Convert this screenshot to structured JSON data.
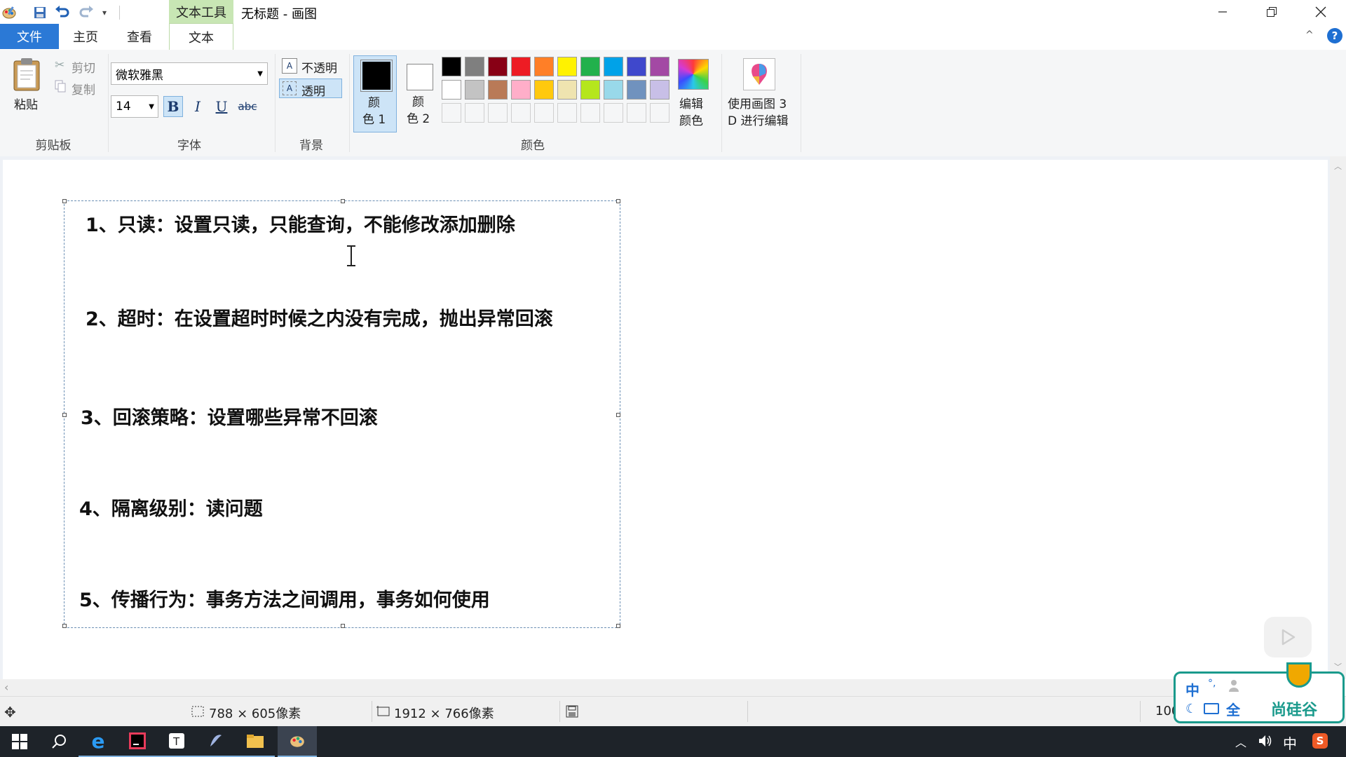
{
  "app": {
    "title": "无标题 - 画图",
    "contextual_tab_group": "文本工具"
  },
  "tabs": [
    {
      "label": "文件",
      "active": false
    },
    {
      "label": "主页",
      "active": false
    },
    {
      "label": "查看",
      "active": false
    },
    {
      "label": "文本",
      "active": true
    }
  ],
  "clipboard": {
    "paste": "粘贴",
    "cut": "剪切",
    "copy": "复制",
    "group_label": "剪贴板"
  },
  "font": {
    "family": "微软雅黑",
    "size": "14",
    "bold": "B",
    "italic": "I",
    "underline": "U",
    "strike": "abc",
    "group_label": "字体"
  },
  "background": {
    "opaque": "不透明",
    "transparent": "透明",
    "group_label": "背景"
  },
  "colors": {
    "color1_a": "颜",
    "color1_b": "色 1",
    "color2_a": "颜",
    "color2_b": "色 2",
    "edit_a": "编辑",
    "edit_b": "颜色",
    "group_label": "颜色",
    "color1_value": "#000000",
    "color2_value": "#ffffff",
    "palette_row1": [
      "#000000",
      "#7f7f7f",
      "#880015",
      "#ed1c24",
      "#ff7f27",
      "#fff200",
      "#22b14c",
      "#00a2e8",
      "#3f48cc",
      "#a349a4"
    ],
    "palette_row2": [
      "#ffffff",
      "#c3c3c3",
      "#b97a57",
      "#ffaec9",
      "#ffc90e",
      "#efe4b0",
      "#b5e61d",
      "#99d9ea",
      "#7092be",
      "#c8bfe7"
    ]
  },
  "paint3d": {
    "line1": "使用画图 3",
    "line2": "D 进行编辑"
  },
  "canvas_text": [
    "1、只读：设置只读，只能查询，不能修改添加删除",
    "2、超时：在设置超时时候之内没有完成，抛出异常回滚",
    "3、回滚策略：设置哪些异常不回滚",
    "4、隔离级别：读问题",
    "5、传播行为：事务方法之间调用，事务如何使用"
  ],
  "status": {
    "selection_size": "788 × 605像素",
    "image_size": "1912 × 766像素",
    "zoom": "100"
  },
  "ime": {
    "lang": "中",
    "brand": "尚硅谷"
  },
  "tray": {
    "lang": "中"
  }
}
